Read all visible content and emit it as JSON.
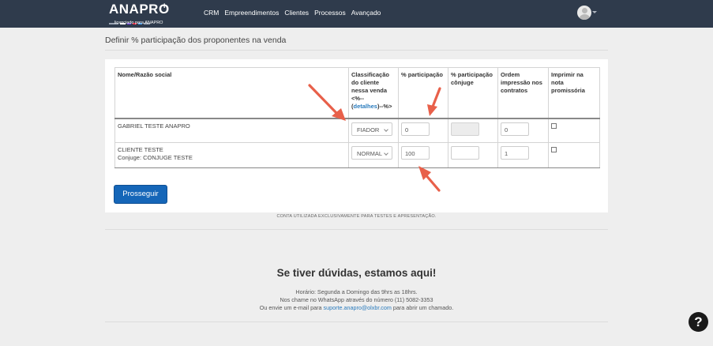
{
  "header": {
    "logo_text": "ANAPRO",
    "logo_sub": "licenciado para ANAPRO",
    "nav": [
      "CRM",
      "Empreendimentos",
      "Clientes",
      "Processos",
      "Avançado"
    ],
    "colors": {
      "bar": "#2f3b4c"
    }
  },
  "page": {
    "title": "Definir % participação dos proponentes na venda"
  },
  "table": {
    "columns": {
      "name": "Nome/Razão social",
      "classification_1": "Classificação do cliente nessa venda",
      "classification_2": "<%--",
      "classification_link": "detalhes",
      "classification_3": "--%>",
      "participation": "% participação",
      "spouse_participation": "% participação cônjuge",
      "print_order": "Ordem impressão nos contratos",
      "print_note": "Imprimir na nota promissória"
    },
    "rows": [
      {
        "name": "GABRIEL TESTE ANAPRO",
        "spouse": "",
        "classification": "FIADOR",
        "participation": "0",
        "spouse_participation": "",
        "print_order": "0"
      },
      {
        "name": "CLIENTE TESTE",
        "spouse": "Conjuge: CONJUGE TESTE",
        "classification": "NORMAL",
        "participation": "100",
        "spouse_participation": "",
        "print_order": "1"
      }
    ]
  },
  "actions": {
    "proceed": "Prosseguir"
  },
  "disclaimer": "CONTA UTILIZADA EXCLUSIVAMENTE PARA TESTES E APRESENTAÇÃO.",
  "help": {
    "title": "Se tiver dúvidas, estamos aqui!",
    "line1": "Horário: Segunda a Domingo das 9hrs as 18hrs.",
    "line2": "Nos chame no WhatsApp através do número (11) 5082-3353",
    "line3_pre": "Ou envie um e-mail para",
    "email": "suporte.anapro@olxbr.com",
    "line3_post": "para abrir um chamado."
  },
  "fab_label": "?"
}
